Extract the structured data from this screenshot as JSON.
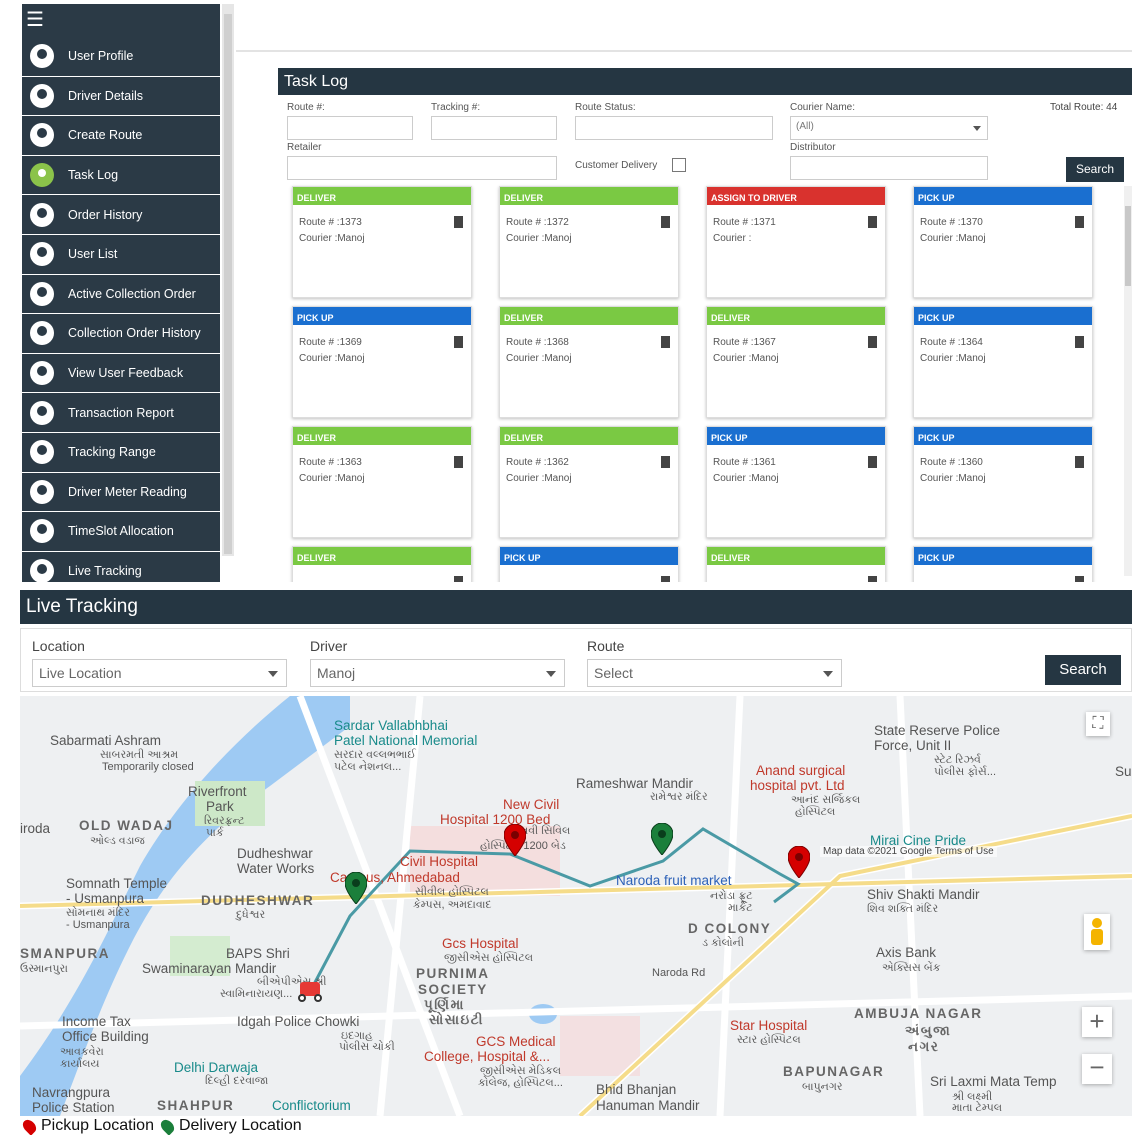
{
  "sidebar": {
    "menu_icon": "hamburger-icon",
    "items": [
      {
        "label": "User Profile",
        "icon": "user-icon"
      },
      {
        "label": "Driver Details",
        "icon": "users-icon"
      },
      {
        "label": "Create Route",
        "icon": "route-icon"
      },
      {
        "label": "Task Log",
        "icon": "check-icon"
      },
      {
        "label": "Order History",
        "icon": "history-icon"
      },
      {
        "label": "User List",
        "icon": "users-icon"
      },
      {
        "label": "Active Collection Order",
        "icon": "collection-icon"
      },
      {
        "label": "Collection Order History",
        "icon": "collection-history-icon"
      },
      {
        "label": "View User Feedback",
        "icon": "thumbs-up-icon"
      },
      {
        "label": "Transaction Report",
        "icon": "report-icon"
      },
      {
        "label": "Tracking Range",
        "icon": "tracking-icon"
      },
      {
        "label": "Driver Meter Reading",
        "icon": "meter-icon"
      },
      {
        "label": "TimeSlot Allocation",
        "icon": "clock-icon"
      },
      {
        "label": "Live Tracking",
        "icon": "location-icon"
      }
    ]
  },
  "task_log": {
    "title": "Task Log",
    "filters": {
      "route_label": "Route #:",
      "tracking_label": "Tracking #:",
      "route_status_label": "Route Status:",
      "courier_name_label": "Courier Name:",
      "courier_name_value": "(All)",
      "total_route": "Total Route: 44",
      "retailer_label": "Retailer",
      "customer_delivery_label": "Customer Delivery",
      "distributor_label": "Distributor",
      "search_label": "Search"
    },
    "cards": [
      {
        "status": "DELIVER",
        "route": "Route # :1373",
        "courier": "Courier :Manoj",
        "color": "#7ac943"
      },
      {
        "status": "DELIVER",
        "route": "Route # :1372",
        "courier": "Courier :Manoj",
        "color": "#7ac943"
      },
      {
        "status": "ASSIGN TO DRIVER",
        "route": "Route # :1371",
        "courier": "Courier :",
        "color": "#d9322e"
      },
      {
        "status": "PICK UP",
        "route": "Route # :1370",
        "courier": "Courier :Manoj",
        "color": "#1a6fd0"
      },
      {
        "status": "PICK UP",
        "route": "Route # :1369",
        "courier": "Courier :Manoj",
        "color": "#1a6fd0"
      },
      {
        "status": "DELIVER",
        "route": "Route # :1368",
        "courier": "Courier :Manoj",
        "color": "#7ac943"
      },
      {
        "status": "DELIVER",
        "route": "Route # :1367",
        "courier": "Courier :Manoj",
        "color": "#7ac943"
      },
      {
        "status": "PICK UP",
        "route": "Route # :1364",
        "courier": "Courier :Manoj",
        "color": "#1a6fd0"
      },
      {
        "status": "DELIVER",
        "route": "Route # :1363",
        "courier": "Courier :Manoj",
        "color": "#7ac943"
      },
      {
        "status": "DELIVER",
        "route": "Route # :1362",
        "courier": "Courier :Manoj",
        "color": "#7ac943"
      },
      {
        "status": "PICK UP",
        "route": "Route # :1361",
        "courier": "Courier :Manoj",
        "color": "#1a6fd0"
      },
      {
        "status": "PICK UP",
        "route": "Route # :1360",
        "courier": "Courier :Manoj",
        "color": "#1a6fd0"
      },
      {
        "status": "DELIVER",
        "route": "",
        "courier": "",
        "color": "#7ac943"
      },
      {
        "status": "PICK UP",
        "route": "",
        "courier": "",
        "color": "#1a6fd0"
      },
      {
        "status": "DELIVER",
        "route": "",
        "courier": "",
        "color": "#7ac943"
      },
      {
        "status": "PICK UP",
        "route": "",
        "courier": "",
        "color": "#1a6fd0"
      }
    ]
  },
  "live_tracking": {
    "title": "Live Tracking",
    "location_label": "Location",
    "location_value": "Live Location",
    "driver_label": "Driver",
    "driver_value": "Manoj",
    "route_label": "Route",
    "route_value": "Select",
    "search_label": "Search",
    "map_credit": "Map data ©2021 Google",
    "map_terms": "Terms of Use",
    "legend_pickup": "Pickup Location",
    "legend_delivery": "Delivery Location",
    "route_color": "#4a9aa5",
    "pickup_color": "#d50000",
    "delivery_color": "#1b7f3b"
  },
  "map_labels": [
    {
      "text": "Sabarmati Ashram",
      "cls": ""
    },
    {
      "text": "સાબરમતી આશ્રમ",
      "cls": "small"
    },
    {
      "text": "Temporarily closed",
      "cls": "small"
    },
    {
      "text": "Sardar Vallabhbhai",
      "cls": "teal"
    },
    {
      "text": "Patel National Memorial",
      "cls": "teal"
    },
    {
      "text": "સરદાર વલ્લભભાઈ",
      "cls": "small"
    },
    {
      "text": "પટેલ નેશનલ...",
      "cls": "small"
    },
    {
      "text": "State Reserve Police",
      "cls": ""
    },
    {
      "text": "Force, Unit II",
      "cls": ""
    },
    {
      "text": "સ્ટેટ રિઝર્વ",
      "cls": "small"
    },
    {
      "text": "પોલીસ ફોર્સ...",
      "cls": "small"
    },
    {
      "text": "Su",
      "cls": ""
    },
    {
      "text": "Riverfront",
      "cls": ""
    },
    {
      "text": "Park",
      "cls": ""
    },
    {
      "text": "રિવરફ્રન્ટ",
      "cls": "small"
    },
    {
      "text": "પાર્ક",
      "cls": "small"
    },
    {
      "text": "Rameshwar Mandir",
      "cls": ""
    },
    {
      "text": "રામેશ્વર મંદિર",
      "cls": "small"
    },
    {
      "text": "Anand surgical",
      "cls": "red"
    },
    {
      "text": "hospital pvt. Ltd",
      "cls": "red"
    },
    {
      "text": "આનંદ સર્જિકલ",
      "cls": "small"
    },
    {
      "text": "હોસ્પિટલ",
      "cls": "small"
    },
    {
      "text": "iroda",
      "cls": ""
    },
    {
      "text": "OLD WADAJ",
      "cls": "bold"
    },
    {
      "text": "ઓલ્ડ વડાજ",
      "cls": "small"
    },
    {
      "text": "New Civil",
      "cls": "red"
    },
    {
      "text": "Hospital 1200 Bed",
      "cls": "red"
    },
    {
      "text": "નવી સિવિલ",
      "cls": "small"
    },
    {
      "text": "હોસ્પિટલ 1200 બેડ",
      "cls": "small"
    },
    {
      "text": "Mirai Cine Pride",
      "cls": "teal"
    },
    {
      "text": "Dudheshwar",
      "cls": ""
    },
    {
      "text": "Water Works",
      "cls": ""
    },
    {
      "text": "Civil Hospital",
      "cls": "red"
    },
    {
      "text": "Campus, Ahmedabad",
      "cls": "red"
    },
    {
      "text": "સીવીલ હોસ્પિટલ",
      "cls": "small"
    },
    {
      "text": "કેમ્પસ, અમદાવાદ",
      "cls": "small"
    },
    {
      "text": "Naroda fruit market",
      "cls": "blue"
    },
    {
      "text": "નરોડા ફ્રૂટ",
      "cls": "small"
    },
    {
      "text": "માર્કેટ",
      "cls": "small"
    },
    {
      "text": "Somnath Temple",
      "cls": ""
    },
    {
      "text": "- Usmanpura",
      "cls": ""
    },
    {
      "text": "સોમનાથ મંદિર",
      "cls": "small"
    },
    {
      "text": "- Usmanpura",
      "cls": "small"
    },
    {
      "text": "DUDHESHWAR",
      "cls": "bold"
    },
    {
      "text": "દુધેશ્વર",
      "cls": "small"
    },
    {
      "text": "Shiv Shakti Mandir",
      "cls": ""
    },
    {
      "text": "શિવ શક્તિ મંદિર",
      "cls": "small"
    },
    {
      "text": "D COLONY",
      "cls": "bold"
    },
    {
      "text": "ડ કોલોની",
      "cls": "small"
    },
    {
      "text": "Gcs Hospital",
      "cls": "red"
    },
    {
      "text": "જીસીએસ હોસ્પિટલ",
      "cls": "small"
    },
    {
      "text": "SMANPURA",
      "cls": "bold"
    },
    {
      "text": "ઉસ્માનપુરા",
      "cls": "small"
    },
    {
      "text": "BAPS Shri",
      "cls": ""
    },
    {
      "text": "Swaminarayan Mandir",
      "cls": ""
    },
    {
      "text": "બીએપીએસ શ્રી",
      "cls": "small"
    },
    {
      "text": "સ્વામિનારાયણ...",
      "cls": "small"
    },
    {
      "text": "PURNIMA",
      "cls": "bold"
    },
    {
      "text": "SOCIETY",
      "cls": "bold"
    },
    {
      "text": "પૂર્ણિમા",
      "cls": "bold"
    },
    {
      "text": "સોસાઇટી",
      "cls": "bold"
    },
    {
      "text": "Axis Bank",
      "cls": ""
    },
    {
      "text": "એક્સિસ બેંક",
      "cls": "small"
    },
    {
      "text": "Naroda Rd",
      "cls": "small"
    },
    {
      "text": "Income Tax",
      "cls": ""
    },
    {
      "text": "Office Building",
      "cls": ""
    },
    {
      "text": "આવકવેરા",
      "cls": "small"
    },
    {
      "text": "કાર્યાલય",
      "cls": "small"
    },
    {
      "text": "Idgah Police Chowki",
      "cls": ""
    },
    {
      "text": "ઇદગાહ",
      "cls": "small"
    },
    {
      "text": "પોલીસ ચોકી",
      "cls": "small"
    },
    {
      "text": "AMBUJA NAGAR",
      "cls": "bold"
    },
    {
      "text": "અંબુજા",
      "cls": "bold"
    },
    {
      "text": "નગર",
      "cls": "bold"
    },
    {
      "text": "Star Hospital",
      "cls": "red"
    },
    {
      "text": "સ્ટાર હોસ્પિટલ",
      "cls": "small"
    },
    {
      "text": "GCS Medical",
      "cls": "red"
    },
    {
      "text": "College, Hospital &...",
      "cls": "red"
    },
    {
      "text": "જીસીએસ મેડિકલ",
      "cls": "small"
    },
    {
      "text": "કોલેજ, હોસ્પિટલ...",
      "cls": "small"
    },
    {
      "text": "Delhi Darwaja",
      "cls": "teal"
    },
    {
      "text": "દિલ્હી દરવાજા",
      "cls": "small"
    },
    {
      "text": "BAPUNAGAR",
      "cls": "bold"
    },
    {
      "text": "બાપુનગર",
      "cls": "small"
    },
    {
      "text": "Sri Laxmi Mata Temp",
      "cls": ""
    },
    {
      "text": "શ્રી લક્ષ્મી",
      "cls": "small"
    },
    {
      "text": "માતા ટેમ્પલ",
      "cls": "small"
    },
    {
      "text": "Navrangpura",
      "cls": ""
    },
    {
      "text": "Police Station",
      "cls": ""
    },
    {
      "text": "SHAHPUR",
      "cls": "bold"
    },
    {
      "text": "Conflictorium",
      "cls": "teal"
    },
    {
      "text": "Bhid Bhanjan",
      "cls": ""
    },
    {
      "text": "Hanuman Mandir",
      "cls": ""
    }
  ]
}
